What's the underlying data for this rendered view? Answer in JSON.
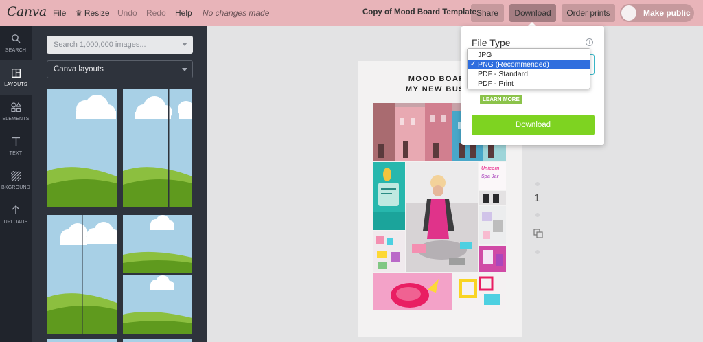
{
  "topbar": {
    "logo": "Canva",
    "menu": [
      "File",
      "Resize",
      "Undo",
      "Redo",
      "Help"
    ],
    "status": "No changes made",
    "doc_title": "Copy of Mood Board Template",
    "share": "Share",
    "download": "Download",
    "order_prints": "Order prints",
    "make_public": "Make public"
  },
  "rail": {
    "items": [
      {
        "label": "SEARCH",
        "icon": "search-icon"
      },
      {
        "label": "LAYOUTS",
        "icon": "layouts-icon"
      },
      {
        "label": "ELEMENTS",
        "icon": "elements-icon"
      },
      {
        "label": "TEXT",
        "icon": "text-icon"
      },
      {
        "label": "BKGROUND",
        "icon": "background-icon"
      },
      {
        "label": "UPLOADS",
        "icon": "upload-icon"
      }
    ]
  },
  "panel": {
    "search_placeholder": "Search 1,000,000 images...",
    "layouts_select": "Canva layouts"
  },
  "canvas": {
    "title_line1": "MOOD BOARD",
    "title_line2": "MY NEW BUSIN",
    "page_number": "1",
    "photo_text_1": "Unicorn",
    "photo_text_2": "Spa Jar"
  },
  "download_panel": {
    "file_type_label": "File Type",
    "options": [
      "JPG",
      "PNG (Recommended)",
      "PDF - Standard",
      "PDF - Print"
    ],
    "selected": "PNG (Recommended)",
    "learn_more": "LEARN MORE",
    "download_button": "Download"
  },
  "colors": {
    "topbar": "#e8b4b9",
    "rail": "#20242c",
    "panel": "#2e333c",
    "accent_green": "#7ed321",
    "select_blue": "#2f6ede"
  }
}
